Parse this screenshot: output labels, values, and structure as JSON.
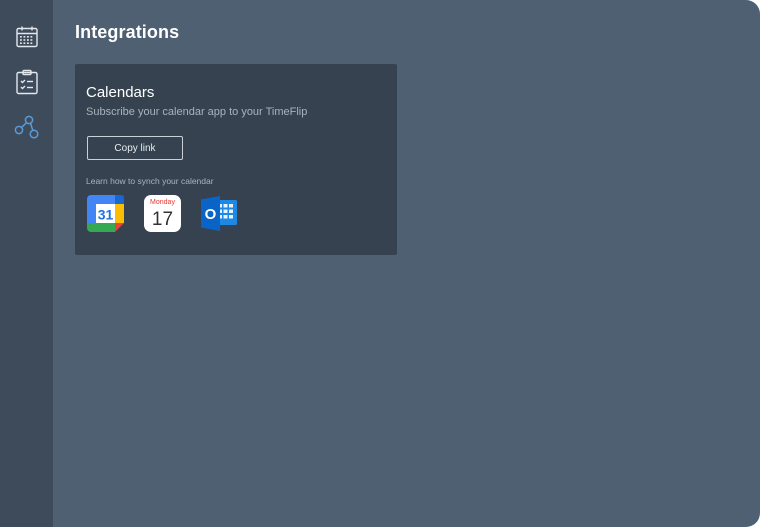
{
  "sidebar": {
    "items": [
      {
        "icon": "calendar-icon"
      },
      {
        "icon": "clipboard-checklist-icon"
      },
      {
        "icon": "integrations-share-icon",
        "active": true
      }
    ]
  },
  "page": {
    "title": "Integrations"
  },
  "calendars_card": {
    "title": "Calendars",
    "subtitle": "Subscribe your calendar app to your TimeFlip",
    "copy_button_label": "Copy link",
    "learn_text": "Learn how to synch your calendar",
    "apps": [
      {
        "icon": "google-calendar-icon",
        "label": "31"
      },
      {
        "icon": "apple-calendar-icon",
        "day": "Monday",
        "date": "17"
      },
      {
        "icon": "outlook-calendar-icon",
        "letter": "O"
      }
    ]
  },
  "colors": {
    "background": "#4f6072",
    "sidebar": "#3d4b5b",
    "card": "#36424f",
    "active_icon": "#5b9bd5"
  }
}
